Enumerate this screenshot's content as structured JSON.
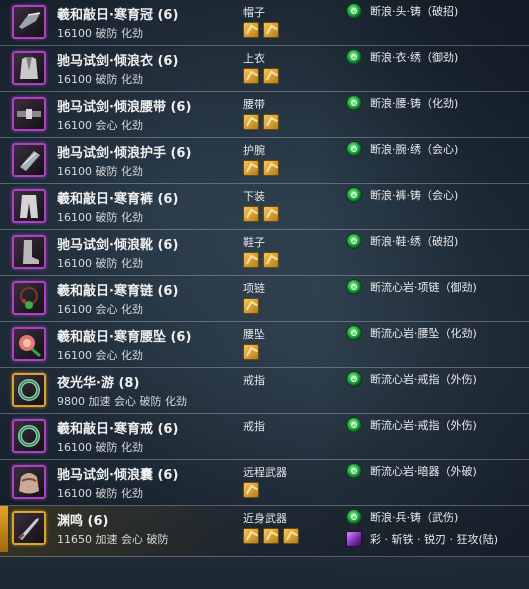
{
  "equipment": [
    {
      "name": "羲和敲日·寒育冠 (6)",
      "stats": "16100 破防 化劲",
      "slot": "帽子",
      "stones": 2,
      "enchant": "断浪·头·铸（破招)",
      "frame": "purple",
      "icon": "helmet-icon"
    },
    {
      "name": "驰马试剑·倾浪衣 (6)",
      "stats": "16100 破防 化劲",
      "slot": "上衣",
      "stones": 2,
      "enchant": "断浪·衣·绣（御劲)",
      "frame": "purple",
      "icon": "armor-icon"
    },
    {
      "name": "驰马试剑·倾浪腰带 (6)",
      "stats": "16100 会心 化劲",
      "slot": "腰带",
      "stones": 2,
      "enchant": "断浪·腰·铸（化劲)",
      "frame": "purple",
      "icon": "belt-icon"
    },
    {
      "name": "驰马试剑·倾浪护手 (6)",
      "stats": "16100 破防 化劲",
      "slot": "护腕",
      "stones": 2,
      "enchant": "断浪·腕·绣（会心)",
      "frame": "purple",
      "icon": "bracer-icon"
    },
    {
      "name": "羲和敲日·寒育裤 (6)",
      "stats": "16100 破防 化劲",
      "slot": "下装",
      "stones": 2,
      "enchant": "断浪·裤·铸（会心)",
      "frame": "purple",
      "icon": "pants-icon"
    },
    {
      "name": "驰马试剑·倾浪靴 (6)",
      "stats": "16100 破防 化劲",
      "slot": "鞋子",
      "stones": 2,
      "enchant": "断浪·鞋·绣（破招)",
      "frame": "purple",
      "icon": "boots-icon"
    },
    {
      "name": "羲和敲日·寒育链 (6)",
      "stats": "16100 会心 化劲",
      "slot": "项链",
      "stones": 1,
      "enchant": "断流心岩·项链（御劲)",
      "frame": "purple",
      "icon": "necklace-icon"
    },
    {
      "name": "羲和敲日·寒育腰坠 (6)",
      "stats": "16100 会心 化劲",
      "slot": "腰坠",
      "stones": 1,
      "enchant": "断流心岩·腰坠（化劲)",
      "frame": "purple",
      "icon": "pendant-icon"
    },
    {
      "name": "夜光华·游 (8)",
      "stats": "9800 加速 会心 破防 化劲",
      "slot": "戒指",
      "stones": 0,
      "enchant": "断流心岩·戒指（外伤)",
      "frame": "gold",
      "icon": "ring-icon"
    },
    {
      "name": "羲和敲日·寒育戒 (6)",
      "stats": "16100 破防 化劲",
      "slot": "戒指",
      "stones": 0,
      "enchant": "断流心岩·戒指（外伤)",
      "frame": "purple",
      "icon": "ring-icon"
    },
    {
      "name": "驰马试剑·倾浪囊 (6)",
      "stats": "16100 破防 化劲",
      "slot": "远程武器",
      "stones": 1,
      "enchant": "断流心岩·暗器（外破)",
      "frame": "purple",
      "icon": "pouch-icon"
    },
    {
      "name": "渊鸣 (6)",
      "stats": "11650 加速 会心 破防",
      "slot": "近身武器",
      "stones": 3,
      "enchant": "断浪·兵·铸（武伤)",
      "enchant2": "彩 · 斩铁 · 锐刃 · 狂攻(陆)",
      "frame": "gold",
      "icon": "blade-icon"
    }
  ],
  "colors": {
    "purple_frame": "#b03fc7",
    "gold_frame": "#d9a52c"
  }
}
